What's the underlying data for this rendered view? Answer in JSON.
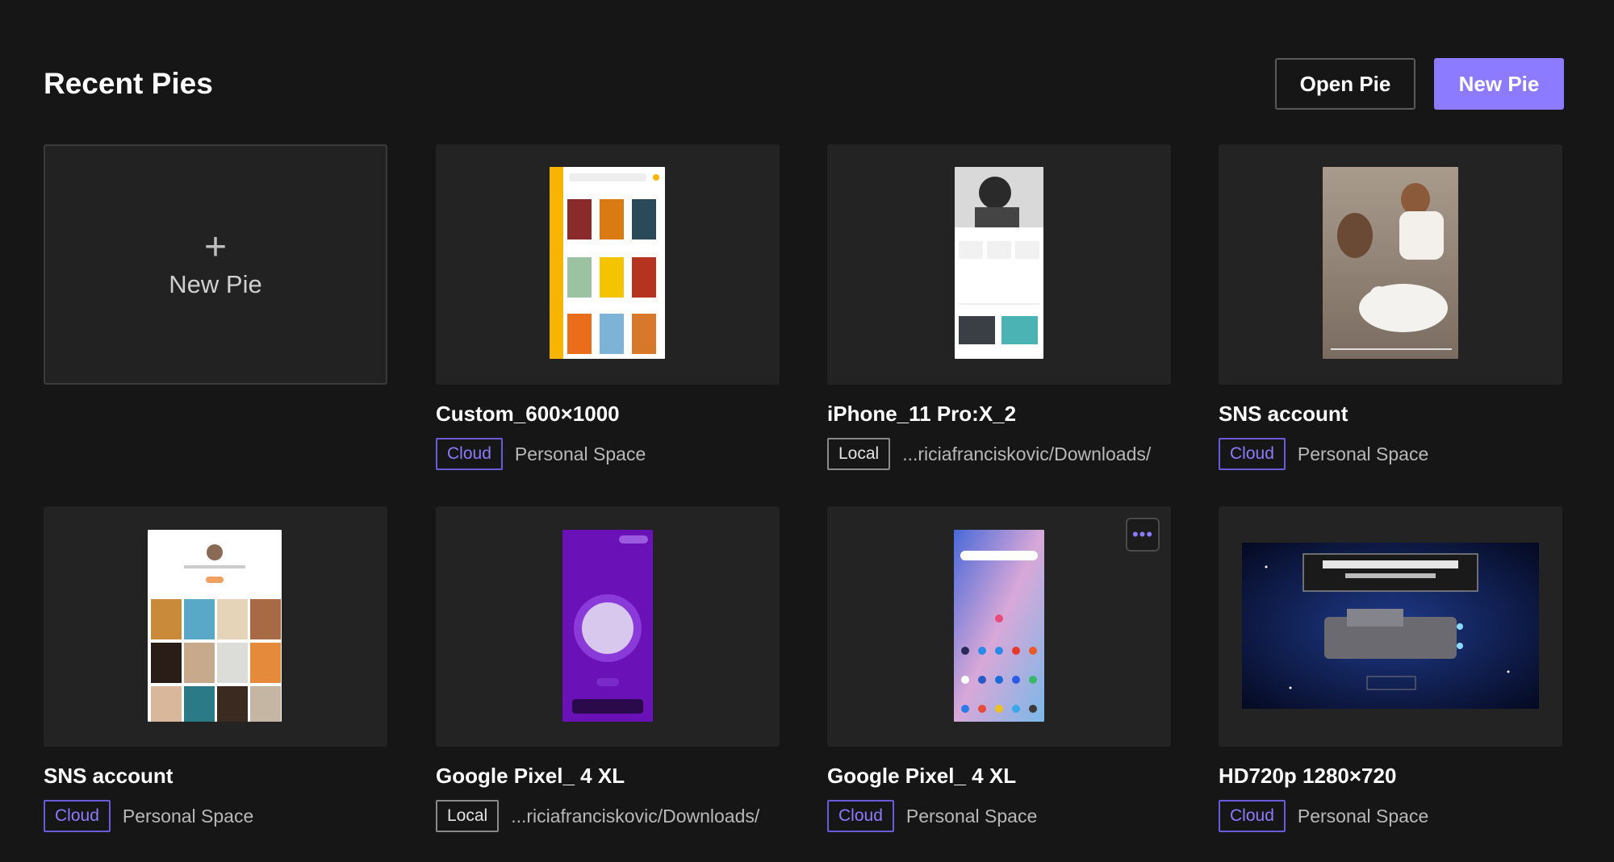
{
  "header": {
    "title": "Recent Pies",
    "open_label": "Open Pie",
    "new_label": "New Pie"
  },
  "new_pie_card": {
    "plus": "+",
    "label": "New Pie"
  },
  "pies": [
    {
      "name": "Custom_600×1000",
      "storage": "Cloud",
      "location": "Personal Space"
    },
    {
      "name": "iPhone_11 Pro:X_2",
      "storage": "Local",
      "location": "...riciafranciskovic/Downloads/"
    },
    {
      "name": "SNS account",
      "storage": "Cloud",
      "location": "Personal Space"
    },
    {
      "name": "SNS account",
      "storage": "Cloud",
      "location": "Personal Space"
    },
    {
      "name": "Google Pixel_ 4 XL",
      "storage": "Local",
      "location": "...riciafranciskovic/Downloads/"
    },
    {
      "name": "Google Pixel_ 4 XL",
      "storage": "Cloud",
      "location": "Personal Space"
    },
    {
      "name": "HD720p 1280×720",
      "storage": "Cloud",
      "location": "Personal Space"
    }
  ],
  "more_button_glyph": "•••",
  "colors": {
    "accent": "#8d7bff",
    "background": "#161616",
    "card": "#232323"
  },
  "icons": [
    "plus-icon",
    "more-options-icon"
  ]
}
